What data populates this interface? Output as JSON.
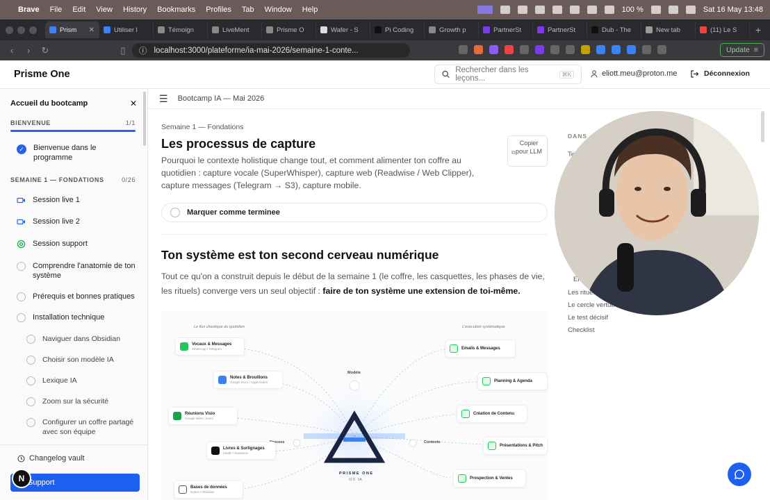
{
  "menubar": {
    "app": "Brave",
    "items": [
      "File",
      "Edit",
      "View",
      "History",
      "Bookmarks",
      "Profiles",
      "Tab",
      "Window",
      "Help"
    ],
    "battery": "100 %",
    "datetime": "Sat 16 May  13:48"
  },
  "tabs": [
    {
      "label": "Prism"
    },
    {
      "label": "Utiliser l"
    },
    {
      "label": "Témoign"
    },
    {
      "label": "LiveMent"
    },
    {
      "label": "Prisme O"
    },
    {
      "label": "Wafer - S"
    },
    {
      "label": "Pi Coding"
    },
    {
      "label": "Growth p"
    },
    {
      "label": "PartnerSt"
    },
    {
      "label": "PartnerSt"
    },
    {
      "label": "Dub - The"
    },
    {
      "label": "New tab"
    },
    {
      "label": "(11) Le S"
    }
  ],
  "browser": {
    "url": "localhost:3000/plateforme/ia-mai-2026/semaine-1-conte...",
    "update_label": "Update"
  },
  "header": {
    "brand": "Prisme One",
    "search_placeholder": "Rechercher dans les leçons...",
    "search_kbd": "⌘K",
    "user_email": "eliott.meu@proton.me",
    "logout_label": "Déconnexion"
  },
  "sidebar": {
    "title": "Accueil du bootcamp",
    "section1": {
      "label": "BIENVENUE",
      "count": "1/1",
      "progress": 1.0
    },
    "welcome_item": "Bienvenue dans le programme",
    "section2": {
      "label": "SEMAINE 1 — FONDATIONS",
      "count": "0/26"
    },
    "items": [
      {
        "label": "Session live 1",
        "icon": "video-icon"
      },
      {
        "label": "Session live 2",
        "icon": "video-icon"
      },
      {
        "label": "Session support",
        "icon": "support-icon"
      },
      {
        "label": "Comprendre l'anatomie de ton système",
        "icon": "circle"
      },
      {
        "label": "Prérequis et bonnes pratiques",
        "icon": "circle"
      },
      {
        "label": "Installation technique",
        "icon": "circle"
      }
    ],
    "sub_items": [
      "Naviguer dans Obsidian",
      "Choisir son modèle IA",
      "Lexique IA",
      "Zoom sur la sécurité",
      "Configurer un coffre partagé avec son équipe"
    ],
    "changelog": "Changelog vault",
    "support": "Support",
    "avatar_letter": "N"
  },
  "main": {
    "breadcrumb": "Bootcamp IA — Mai 2026",
    "week": "Semaine 1 — Fondations",
    "title": "Les processus de capture",
    "lead": "Pourquoi le contexte holistique change tout, et comment alimenter ton coffre au quotidien : capture vocale (SuperWhisper), capture web (Readwise / Web Clipper), capture messages (Telegram → S3), capture mobile.",
    "copy_label": "Copier pour LLM",
    "mark_done": "Marquer comme terminee",
    "h2": "Ton système est ton second cerveau numérique",
    "para_start": "Tout ce qu'on a construit depuis le début de la semaine 1 (le coffre, les casquettes, les phases de vie, les rituels) converge vers un seul objectif : ",
    "para_bold": "faire de ton système une extension de toi-même."
  },
  "toc": {
    "title": "DANS",
    "items": [
      "Te",
      "En",
      "Les rituel",
      "Le cercle vertue",
      "Le test décisif",
      "Checklist"
    ]
  },
  "diagram": {
    "left_caption": "Le flux chaotique du quotidien",
    "right_caption": "L'exécution systématique",
    "model": "Modèle",
    "process": "Process",
    "context": "Contexte",
    "center_line1": "PRISME ONE",
    "center_line2": "OS IA",
    "left_nodes": [
      {
        "title": "Vocaux & Messages",
        "sub": "WhatsApp / Telegram",
        "color": "#22c55e"
      },
      {
        "title": "Notes & Brouillons",
        "sub": "Google Docs / Apple Notes",
        "color": "#3b82f6"
      },
      {
        "title": "Réunions Visio",
        "sub": "Google Meet / Zoom",
        "color": "#16a34a"
      },
      {
        "title": "Livres & Surlignages",
        "sub": "Kindle / Readwise",
        "color": "#111111"
      },
      {
        "title": "Bases de données",
        "sub": "Notion / Obsidian",
        "color": "#555555"
      }
    ],
    "right_nodes": [
      {
        "title": "Emails & Messages",
        "color": "#22c55e"
      },
      {
        "title": "Planning & Agenda",
        "color": "#22c55e"
      },
      {
        "title": "Création de Contenu",
        "color": "#22c55e"
      },
      {
        "title": "Présentations & Pitch",
        "color": "#22c55e"
      },
      {
        "title": "Prospection & Ventes",
        "color": "#22c55e"
      }
    ]
  },
  "colors": {
    "accent": "#1d5ff0",
    "progress": "#2563eb"
  }
}
